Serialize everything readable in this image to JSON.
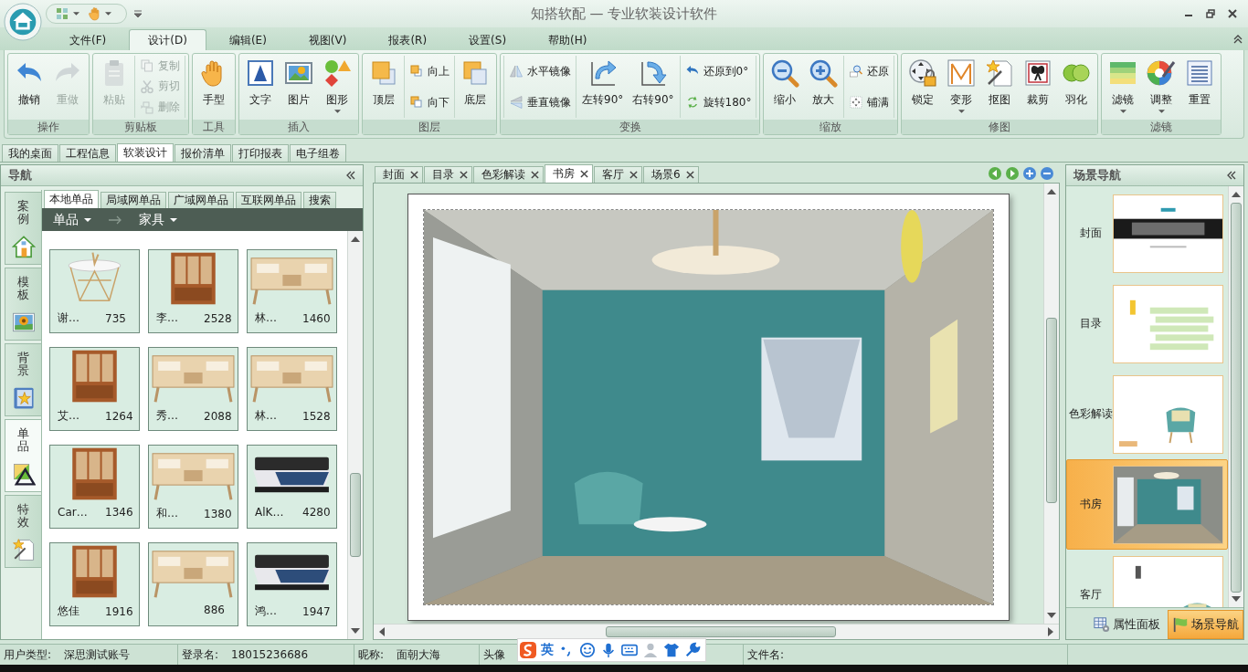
{
  "window": {
    "title": "知搭软配 — 专业软装设计软件"
  },
  "menu_tabs": [
    {
      "label": "文件(F)",
      "selected": false
    },
    {
      "label": "设计(D)",
      "selected": true
    },
    {
      "label": "编辑(E)",
      "selected": false
    },
    {
      "label": "视图(V)",
      "selected": false
    },
    {
      "label": "报表(R)",
      "selected": false
    },
    {
      "label": "设置(S)",
      "selected": false
    },
    {
      "label": "帮助(H)",
      "selected": false
    }
  ],
  "ribbon": {
    "groups": [
      {
        "title": "操作",
        "columns": [
          {
            "kind": "large",
            "label": "撤销",
            "disabled": false
          },
          {
            "kind": "large",
            "label": "重做",
            "disabled": true
          }
        ]
      },
      {
        "title": "剪贴板",
        "columns": [
          {
            "kind": "large",
            "label": "粘贴",
            "disabled": true
          },
          {
            "kind": "stack",
            "items": [
              {
                "label": "复制",
                "disabled": true
              },
              {
                "label": "剪切",
                "disabled": true
              },
              {
                "label": "删除",
                "disabled": true
              }
            ]
          }
        ]
      },
      {
        "title": "工具",
        "columns": [
          {
            "kind": "large",
            "label": "手型",
            "disabled": false
          }
        ]
      },
      {
        "title": "插入",
        "columns": [
          {
            "kind": "large",
            "label": "文字",
            "disabled": false
          },
          {
            "kind": "large",
            "label": "图片",
            "disabled": false
          },
          {
            "kind": "large",
            "label": "图形",
            "disabled": false,
            "dropdown": true
          }
        ]
      },
      {
        "title": "图层",
        "columns": [
          {
            "kind": "large",
            "label": "顶层",
            "disabled": false
          },
          {
            "kind": "stack",
            "items": [
              {
                "label": "向上",
                "disabled": false
              },
              {
                "label": "向下",
                "disabled": false
              }
            ]
          },
          {
            "kind": "large",
            "label": "底层",
            "disabled": false
          }
        ]
      },
      {
        "title": "变换",
        "columns": [
          {
            "kind": "stack",
            "items": [
              {
                "label": "水平镜像",
                "disabled": false
              },
              {
                "label": "垂直镜像",
                "disabled": false
              }
            ]
          },
          {
            "kind": "large",
            "label": "左转90°",
            "disabled": false
          },
          {
            "kind": "large",
            "label": "右转90°",
            "disabled": false
          },
          {
            "kind": "stack",
            "items": [
              {
                "label": "还原到0°",
                "disabled": false
              },
              {
                "label": "旋转180°",
                "disabled": false
              }
            ]
          }
        ]
      },
      {
        "title": "缩放",
        "columns": [
          {
            "kind": "large",
            "label": "缩小",
            "disabled": false
          },
          {
            "kind": "large",
            "label": "放大",
            "disabled": false
          },
          {
            "kind": "stack",
            "items": [
              {
                "label": "还原",
                "disabled": false
              },
              {
                "label": "铺满",
                "disabled": false
              }
            ]
          }
        ]
      },
      {
        "title": "修图",
        "columns": [
          {
            "kind": "large",
            "label": "锁定",
            "disabled": false
          },
          {
            "kind": "large",
            "label": "变形",
            "disabled": false,
            "dropdown": true
          },
          {
            "kind": "large",
            "label": "抠图",
            "disabled": false
          },
          {
            "kind": "large",
            "label": "裁剪",
            "disabled": false
          },
          {
            "kind": "large",
            "label": "羽化",
            "disabled": false
          }
        ]
      },
      {
        "title": "滤镜",
        "columns": [
          {
            "kind": "large",
            "label": "滤镜",
            "disabled": false,
            "dropdown": true
          },
          {
            "kind": "large",
            "label": "调整",
            "disabled": false,
            "dropdown": true
          },
          {
            "kind": "large",
            "label": "重置",
            "disabled": false
          }
        ]
      }
    ]
  },
  "doc_tabs": [
    {
      "label": "我的桌面",
      "selected": false
    },
    {
      "label": "工程信息",
      "selected": false
    },
    {
      "label": "软装设计",
      "selected": true
    },
    {
      "label": "报价清单",
      "selected": false
    },
    {
      "label": "打印报表",
      "selected": false
    },
    {
      "label": "电子组卷",
      "selected": false
    }
  ],
  "navigator": {
    "title": "导航",
    "side_tabs": [
      {
        "label": "案例",
        "selected": false
      },
      {
        "label": "模板",
        "selected": false
      },
      {
        "label": "背景",
        "selected": false
      },
      {
        "label": "单品",
        "selected": true
      },
      {
        "label": "特效",
        "selected": false
      }
    ],
    "tabs": [
      {
        "label": "本地单品",
        "selected": true
      },
      {
        "label": "局域网单品",
        "selected": false
      },
      {
        "label": "广域网单品",
        "selected": false
      },
      {
        "label": "互联网单品",
        "selected": false
      },
      {
        "label": "搜索",
        "selected": false
      }
    ],
    "breadcrumb": [
      "单品",
      "家具"
    ],
    "products": [
      {
        "name": "谢…",
        "price": "735"
      },
      {
        "name": "李…",
        "price": "2528"
      },
      {
        "name": "林…",
        "price": "1460"
      },
      {
        "name": "艾…",
        "price": "1264"
      },
      {
        "name": "秀…",
        "price": "2088"
      },
      {
        "name": "林…",
        "price": "1528"
      },
      {
        "name": "Car…",
        "price": "1346"
      },
      {
        "name": "和…",
        "price": "1380"
      },
      {
        "name": "AlK…",
        "price": "4280"
      },
      {
        "name": "悠佳",
        "price": "1916"
      },
      {
        "price": "886"
      },
      {
        "name": "鸿…",
        "price": "1947"
      }
    ]
  },
  "canvas": {
    "tabs": [
      {
        "label": "封面",
        "selected": false
      },
      {
        "label": "目录",
        "selected": false
      },
      {
        "label": "色彩解读",
        "selected": false
      },
      {
        "label": "书房",
        "selected": true
      },
      {
        "label": "客厅",
        "selected": false
      },
      {
        "label": "场景6",
        "selected": false
      }
    ]
  },
  "scene_nav": {
    "title": "场景导航",
    "scenes": [
      {
        "label": "封面",
        "selected": false
      },
      {
        "label": "目录",
        "selected": false
      },
      {
        "label": "色彩解读",
        "selected": false
      },
      {
        "label": "书房",
        "selected": true
      },
      {
        "label": "客厅",
        "selected": false
      }
    ],
    "bottom_tabs": [
      {
        "label": "属性面板",
        "selected": false
      },
      {
        "label": "场景导航",
        "selected": true
      }
    ]
  },
  "status_bar": [
    {
      "label": "用户类型:",
      "value": "深思测试账号"
    },
    {
      "label": "登录名:",
      "value": "18015236686"
    },
    {
      "label": "昵称:",
      "value": "面朝大海"
    },
    {
      "label": "头像"
    },
    {
      "label": "文件名:"
    }
  ],
  "ime": {
    "mode": "英"
  }
}
